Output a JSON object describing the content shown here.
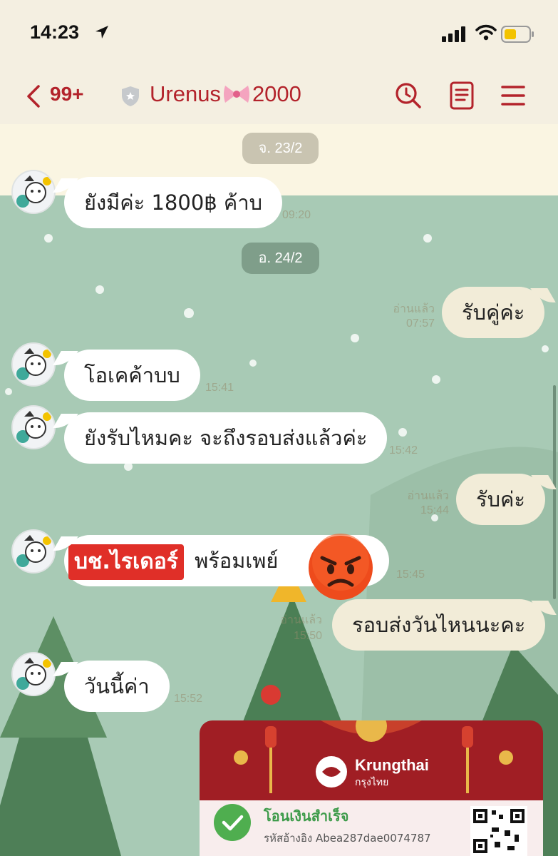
{
  "status_bar": {
    "time": "14:23"
  },
  "header": {
    "unread_count": "99+",
    "chat_title_part1": "Urenus",
    "chat_title_part2": "2000"
  },
  "dates": {
    "d1": "จ. 23/2",
    "d2": "อ. 24/2"
  },
  "messages": [
    {
      "text": "ยังมีค่ะ 1800฿ ค้าบ",
      "meta": "09:20"
    },
    {
      "text": "รับคู่ค่ะ",
      "meta_read": "อ่านแล้ว",
      "meta": "07:57"
    },
    {
      "text": "โอเคค้าบบ",
      "meta": "15:41"
    },
    {
      "text": "ยังรับไหมคะ จะถึงรอบส่งแล้วค่ะ",
      "meta": "15:42"
    },
    {
      "text": "รับค่ะ",
      "meta_read": "อ่านแล้ว",
      "meta": "15:44"
    },
    {
      "tag": "บช.ไรเดอร์",
      "text": "พร้อมเพย์",
      "meta": "15:45"
    },
    {
      "text": "รอบส่งวันไหนนะคะ",
      "meta_read": "อ่านแล้ว",
      "meta": "15:50"
    },
    {
      "text": "วันนี้ค่า",
      "meta": "15:52"
    }
  ],
  "transfer": {
    "brand": "Krungthai",
    "brand_th": "กรุงไทย",
    "status": "โอนเงินสำเร็จ",
    "reference": "รหัสอ้างอิง Abea287dae0074787"
  },
  "colors": {
    "accent": "#b3232b",
    "chat_bg": "#a8cab5",
    "bubble_out": "#f2ecd8",
    "kt_red": "#a01e24"
  }
}
